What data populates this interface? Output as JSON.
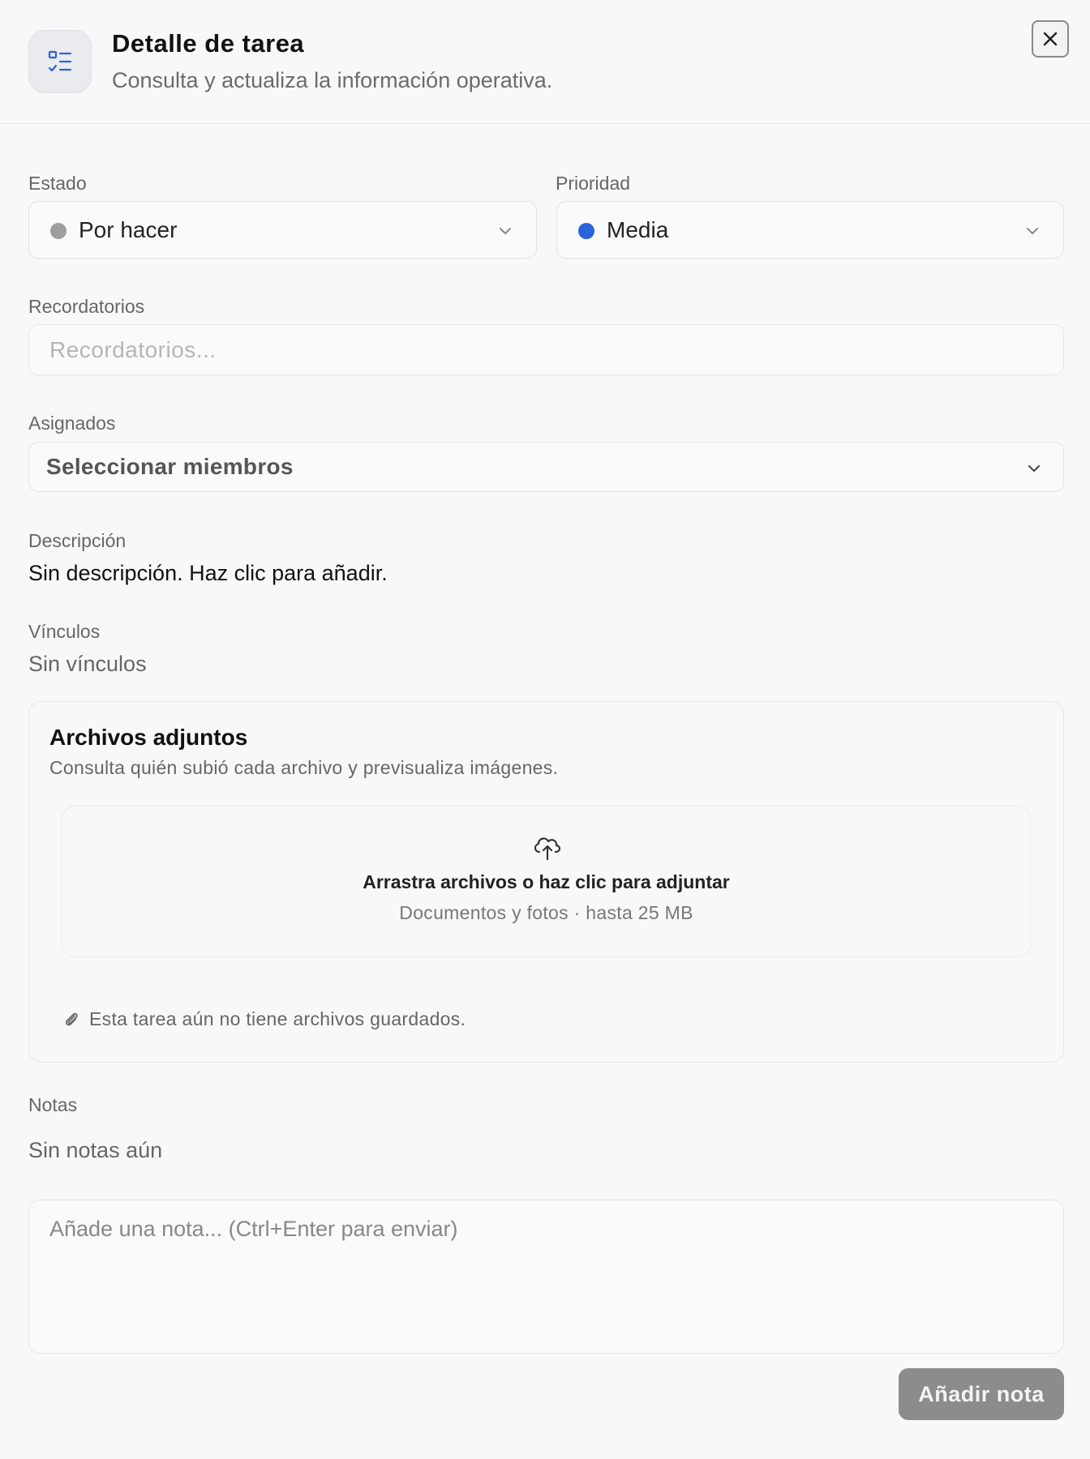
{
  "header": {
    "title": "Detalle de tarea",
    "subtitle": "Consulta y actualiza la información operativa."
  },
  "status": {
    "label": "Estado",
    "value": "Por hacer",
    "color": "#9e9e9e"
  },
  "priority": {
    "label": "Prioridad",
    "value": "Media",
    "color": "#2b63d9"
  },
  "reminders": {
    "label": "Recordatorios",
    "placeholder": "Recordatorios..."
  },
  "assignees": {
    "label": "Asignados",
    "placeholder": "Seleccionar miembros"
  },
  "description": {
    "label": "Descripción",
    "value": "Sin descripción. Haz clic para añadir."
  },
  "links": {
    "label": "Vínculos",
    "value": "Sin vínculos"
  },
  "attachments": {
    "title": "Archivos adjuntos",
    "subtitle": "Consulta quién subió cada archivo y previsualiza imágenes.",
    "dropzone_title": "Arrastra archivos o haz clic para adjuntar",
    "dropzone_hint": "Documentos y fotos · hasta 25 MB",
    "empty_text": "Esta tarea aún no tiene archivos guardados."
  },
  "notes": {
    "label": "Notas",
    "empty": "Sin notas aún",
    "placeholder": "Añade una nota... (Ctrl+Enter para enviar)",
    "submit_label": "Añadir nota"
  },
  "icons": {
    "header": "task-list-icon",
    "close": "close-icon",
    "chevron": "chevron-down-icon",
    "upload": "cloud-upload-icon",
    "attachment": "paperclip-icon"
  }
}
